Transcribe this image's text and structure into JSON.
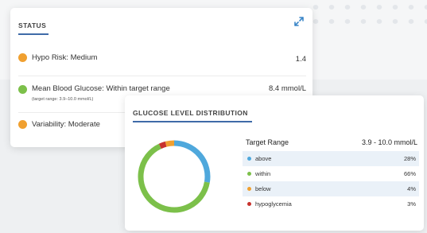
{
  "status": {
    "title": "STATUS",
    "rows": [
      {
        "label": "Hypo Risk: Medium",
        "value": "1.4",
        "sub": "",
        "color": "#f0a030"
      },
      {
        "label": "Mean Blood Glucose: Within target range",
        "value": "8.4 mmol/L",
        "sub": "(target range: 3.9–10.0 mmol/L)",
        "color": "#7cc04a"
      },
      {
        "label": "Variability: Moderate",
        "value": "",
        "sub": "",
        "color": "#f0a030"
      }
    ]
  },
  "distribution": {
    "title": "GLUCOSE LEVEL DISTRIBUTION",
    "header": {
      "label": "Target Range",
      "value": "3.9 - 10.0 mmol/L"
    },
    "rows": [
      {
        "label": "above",
        "value": "28%",
        "percent": 28,
        "color": "#4fa8dc"
      },
      {
        "label": "within",
        "value": "66%",
        "percent": 66,
        "color": "#7cc04a"
      },
      {
        "label": "below",
        "value": "4%",
        "percent": 4,
        "color": "#f0a030"
      },
      {
        "label": "hypoglycemia",
        "value": "3%",
        "percent": 3,
        "color": "#c8322d"
      }
    ]
  },
  "colors": {
    "accent": "#3f6ba8",
    "row_shade": "#eaf1f8"
  },
  "icons": {
    "expand": "expand-arrows-icon"
  }
}
